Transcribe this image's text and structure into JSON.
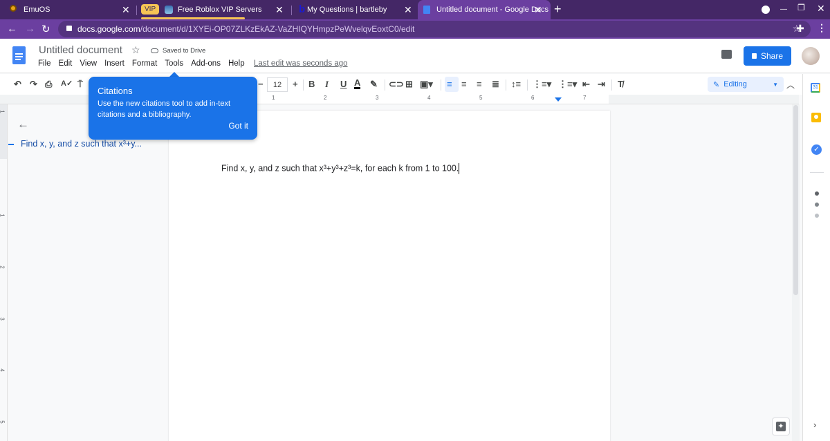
{
  "browser": {
    "tabs": [
      {
        "title": "EmuOS",
        "icon": "emuos-icon",
        "active": false
      },
      {
        "badge": "VIP",
        "title": "Free Roblox VIP Servers",
        "icon": "roblox-icon",
        "active": false
      },
      {
        "title": "My Questions | bartleby",
        "icon": "bartleby-icon",
        "active": false
      },
      {
        "title": "Untitled document - Google Docs",
        "icon": "google-docs-icon",
        "active": true
      }
    ],
    "new_tab_glyph": "+",
    "close_glyph": "✕",
    "url_host": "docs.google.com",
    "url_path": "/document/d/1XYEi-OP07ZLKzEkAZ-VaZHIQYHmpzPeWvelqvEoxtC0/edit",
    "window_controls": {
      "minimize": "—",
      "restore": "❐",
      "close": "✕"
    }
  },
  "docs": {
    "title": "Untitled document",
    "saved_status": "Saved to Drive",
    "menu": [
      "File",
      "Edit",
      "View",
      "Insert",
      "Format",
      "Tools",
      "Add-ons",
      "Help"
    ],
    "last_edit": "Last edit was seconds ago",
    "share_label": "Share",
    "toolbar": {
      "font_size": "12",
      "decrease": "−",
      "increase": "+",
      "bold": "B",
      "italic": "I",
      "underline": "U",
      "text_color": "A",
      "text_color_value": "#000000",
      "mode_label": "Editing"
    },
    "ruler_numbers": [
      "1",
      "2",
      "3",
      "4",
      "5",
      "6",
      "7"
    ],
    "vruler_numbers": [
      "1",
      "1",
      "2",
      "3",
      "4",
      "5"
    ],
    "outline": {
      "items": [
        "Find x, y, and z such that x³+y..."
      ]
    },
    "body_text": "Find x, y, and z such that x³+y³+z³=k, for each k from 1 to 100."
  },
  "tooltip": {
    "title": "Citations",
    "body": "Use the new citations tool to add in-text citations and a bibliography.",
    "button": "Got it"
  },
  "colors": {
    "browser_frame": "#442766",
    "browser_toolbar": "#6b3fa0",
    "accent": "#1a73e8",
    "vip": "#f6c454"
  }
}
